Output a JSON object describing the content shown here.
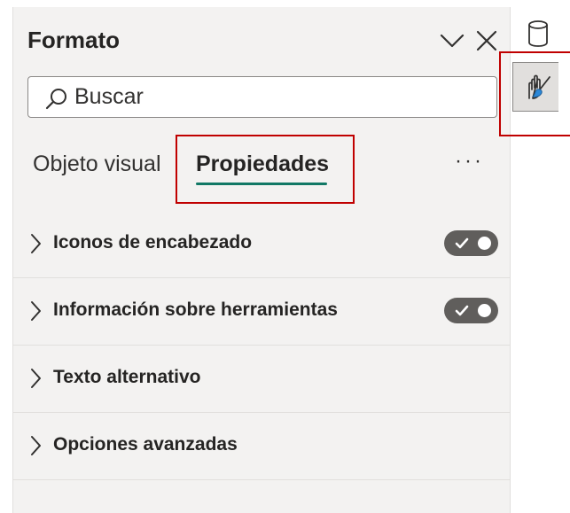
{
  "pane": {
    "title": "Formato",
    "search": {
      "placeholder": "Buscar",
      "value": ""
    },
    "tabs": [
      {
        "label": "Objeto visual",
        "active": false
      },
      {
        "label": "Propiedades",
        "active": true
      }
    ],
    "more_label": "···",
    "sections": [
      {
        "label": "Iconos de encabezado",
        "toggle": true,
        "toggle_on": true
      },
      {
        "label": "Información sobre herramientas",
        "toggle": true,
        "toggle_on": true
      },
      {
        "label": "Texto alternativo",
        "toggle": false
      },
      {
        "label": "Opciones avanzadas",
        "toggle": false
      }
    ]
  },
  "icons": {
    "collapse": "chevron-down-icon",
    "close": "close-icon",
    "search": "search-icon",
    "expand": "chevron-right-icon",
    "toggle_check": "check-icon",
    "data_pane": "database-icon",
    "format_pane": "format-brush-icon"
  },
  "colors": {
    "pane_background": "#f3f2f1",
    "active_tab_underline": "#117865",
    "toggle_on": "#605e5c",
    "highlight": "#c00000",
    "text": "#252423"
  }
}
